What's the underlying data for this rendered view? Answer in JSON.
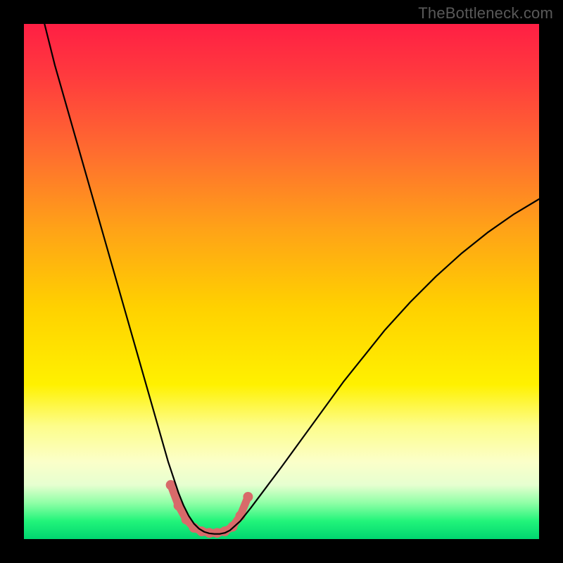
{
  "watermark": "TheBottleneck.com",
  "chart_data": {
    "type": "line",
    "title": "",
    "xlabel": "",
    "ylabel": "",
    "xlim": [
      0,
      100
    ],
    "ylim": [
      0,
      100
    ],
    "grid": false,
    "legend": false,
    "background_gradient": {
      "stops": [
        {
          "offset": 0.0,
          "color": "#ff1f44"
        },
        {
          "offset": 0.1,
          "color": "#ff3a3e"
        },
        {
          "offset": 0.25,
          "color": "#ff6d2f"
        },
        {
          "offset": 0.4,
          "color": "#ffa317"
        },
        {
          "offset": 0.55,
          "color": "#ffd100"
        },
        {
          "offset": 0.7,
          "color": "#fff100"
        },
        {
          "offset": 0.78,
          "color": "#fdfd8a"
        },
        {
          "offset": 0.85,
          "color": "#fbffc9"
        },
        {
          "offset": 0.895,
          "color": "#e6ffd0"
        },
        {
          "offset": 0.93,
          "color": "#8fffa6"
        },
        {
          "offset": 0.965,
          "color": "#22f47a"
        },
        {
          "offset": 1.0,
          "color": "#00d670"
        }
      ]
    },
    "series": [
      {
        "name": "bottleneck-curve",
        "color": "#000000",
        "stroke_width": 2.2,
        "x": [
          4,
          6,
          8,
          10,
          12,
          14,
          16,
          18,
          20,
          22,
          24,
          26,
          27,
          28,
          29,
          30,
          31,
          32,
          33,
          34,
          35,
          36,
          37,
          38,
          39,
          40,
          42,
          44,
          47,
          50,
          54,
          58,
          62,
          66,
          70,
          75,
          80,
          85,
          90,
          95,
          100
        ],
        "y": [
          100,
          92,
          85,
          78,
          71,
          64,
          57,
          50,
          43,
          36,
          29,
          22,
          18.5,
          15,
          12,
          9,
          6.5,
          4.5,
          3,
          2,
          1.4,
          1.1,
          1.0,
          1.0,
          1.2,
          1.7,
          3.5,
          6,
          10,
          14,
          19.5,
          25,
          30.5,
          35.5,
          40.5,
          46,
          51,
          55.5,
          59.5,
          63,
          66
        ]
      }
    ],
    "marker_path": {
      "name": "valley-markers",
      "color": "#d86a6a",
      "stroke_width": 11,
      "dot_radius": 7,
      "x": [
        28.5,
        30,
        31.5,
        33,
        34.5,
        36,
        37.5,
        39,
        40.5,
        42,
        43.5
      ],
      "y": [
        10.5,
        6.5,
        3.8,
        2.2,
        1.5,
        1.2,
        1.2,
        1.5,
        2.4,
        4.5,
        8.2
      ]
    }
  }
}
